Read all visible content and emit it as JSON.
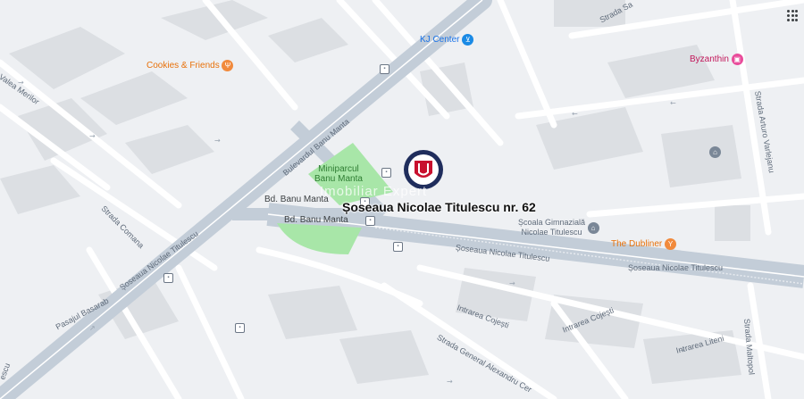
{
  "map": {
    "marker_title": "Șoseaua Nicolae Titulescu nr. 62",
    "watermark": "Imobiliar Expert",
    "colors": {
      "road": "#ffffff",
      "major_road": "#c3cdd8",
      "block": "#dcdfe3",
      "park": "#a8e6a8",
      "background": "#eef0f3",
      "marker_ring": "#1f2d5c",
      "marker_logo": "#c8102e"
    },
    "streets": {
      "bulevardul_banu_manta": "Bulevardul Banu Manta",
      "bd_banu_manta_1": "Bd. Banu Manta",
      "bd_banu_manta_2": "Bd. Banu Manta",
      "soseaua_titulescu_left": "Șoseaua Nicolae Titulescu",
      "soseaua_titulescu_mid": "Șoseaua Nicolae Titulescu",
      "soseaua_titulescu_right": "Șoseaua Nicolae Titulescu",
      "valea_merilor": "Valea Merilor",
      "strada_comana": "Strada Comana",
      "pasajul_basarab": "Pasajul Basarab",
      "intrarea_cojesti_1": "Intrarea Cojești",
      "intrarea_cojesti_2": "Intrarea Cojești",
      "strada_general": "Strada General Alexandru Cer",
      "intrarea_liteni": "Intrarea Liteni",
      "strada_maltopol": "Strada Maltopol",
      "strada_arturo": "Strada Arturo Varlejanu",
      "strada_sa": "Strada Sa",
      "titulescu_bottom_left": "escu"
    },
    "pois": {
      "cookies": {
        "name": "Cookies & Friends",
        "icon": "restaurant-icon",
        "color": "#f18a3c"
      },
      "kj_center": {
        "name": "KJ Center",
        "icon": "shopping-cart-icon",
        "color": "#1a8ae5"
      },
      "byzanthin": {
        "name": "Byzanthin",
        "icon": "shopping-bag-icon",
        "color": "#e94c9b"
      },
      "scoala": {
        "name": "Școala Gimnazială Nicolae Titulescu",
        "line1": "Școala Gimnazială",
        "line2": "Nicolae Titulescu",
        "icon": "school-icon",
        "color": "#7a8797"
      },
      "dubliner": {
        "name": "The Dubliner",
        "icon": "bar-icon",
        "color": "#f18a3c"
      },
      "school_icon_top": {
        "icon": "school-icon",
        "color": "#7a8797"
      }
    },
    "park": {
      "line1": "Miniparcul",
      "line2": "Banu Manta"
    }
  }
}
